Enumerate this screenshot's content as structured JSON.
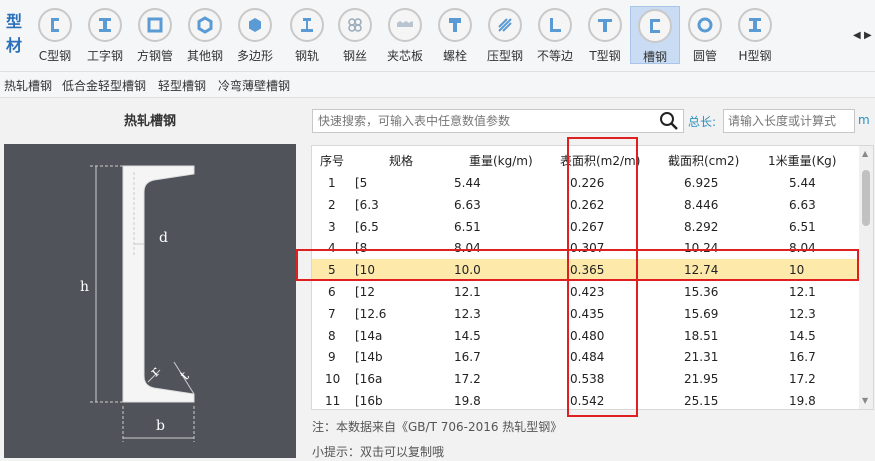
{
  "brand": {
    "chars": [
      "型",
      "材"
    ]
  },
  "toolbar": {
    "items": [
      {
        "label": "C型钢",
        "icon": "c-section-icon"
      },
      {
        "label": "工字钢",
        "icon": "i-beam-icon"
      },
      {
        "label": "方钢管",
        "icon": "square-tube-icon"
      },
      {
        "label": "其他钢",
        "icon": "hexagon-icon"
      },
      {
        "label": "多边形",
        "icon": "polygon-icon"
      },
      {
        "label": "钢轨",
        "icon": "rail-icon"
      },
      {
        "label": "钢丝",
        "icon": "wire-icon"
      },
      {
        "label": "夹芯板",
        "icon": "sandwich-panel-icon"
      },
      {
        "label": "螺栓",
        "icon": "bolt-icon"
      },
      {
        "label": "压型钢",
        "icon": "profiled-steel-icon"
      },
      {
        "label": "不等边",
        "icon": "angle-icon"
      },
      {
        "label": "T型钢",
        "icon": "t-section-icon"
      },
      {
        "label": "槽钢",
        "icon": "channel-icon"
      },
      {
        "label": "圆管",
        "icon": "round-tube-icon"
      },
      {
        "label": "H型钢",
        "icon": "h-beam-icon"
      }
    ],
    "active_label": "槽钢",
    "nav_prev": "◀",
    "nav_next": "▶"
  },
  "subnav": {
    "items": [
      "热轧槽钢",
      "低合金轻型槽钢",
      "轻型槽钢",
      "冷弯薄壁槽钢"
    ]
  },
  "left": {
    "title": "热轧槽钢",
    "dims": {
      "d": "d",
      "h": "h",
      "r": "r",
      "t": "t",
      "b": "b"
    }
  },
  "search": {
    "placeholder": "快速搜索，可输入表中任意数值参数",
    "length_label": "总长:",
    "length_placeholder": "请输入长度或计算式",
    "length_unit": "m"
  },
  "table": {
    "headers": [
      "序号",
      "规格",
      "重量(kg/m)",
      "表面积(m2/m)",
      "截面积(cm2)",
      "1米重量(Kg)"
    ],
    "rows": [
      [
        "1",
        "[5",
        "5.44",
        "0.226",
        "6.925",
        "5.44"
      ],
      [
        "2",
        "[6.3",
        "6.63",
        "0.262",
        "8.446",
        "6.63"
      ],
      [
        "3",
        "[6.5",
        "6.51",
        "0.267",
        "8.292",
        "6.51"
      ],
      [
        "4",
        "[8",
        "8.04",
        "0.307",
        "10.24",
        "8.04"
      ],
      [
        "5",
        "[10",
        "10.0",
        "0.365",
        "12.74",
        "10"
      ],
      [
        "6",
        "[12",
        "12.1",
        "0.423",
        "15.36",
        "12.1"
      ],
      [
        "7",
        "[12.6",
        "12.3",
        "0.435",
        "15.69",
        "12.3"
      ],
      [
        "8",
        "[14a",
        "14.5",
        "0.480",
        "18.51",
        "14.5"
      ],
      [
        "9",
        "[14b",
        "16.7",
        "0.484",
        "21.31",
        "16.7"
      ],
      [
        "10",
        "[16a",
        "17.2",
        "0.538",
        "21.95",
        "17.2"
      ],
      [
        "11",
        "[16b",
        "19.8",
        "0.542",
        "25.15",
        "19.8"
      ]
    ],
    "selected_row": 5
  },
  "footer": {
    "note": "注：本数据来自《GB/T 706-2016 热轧型钢》",
    "tip": "小提示：双击可以复制哦"
  },
  "colors": {
    "accent": "#2a8fbd",
    "highlight": "#e02020",
    "selected_row": "#fde9a9",
    "diagram_bg": "#50535a"
  }
}
